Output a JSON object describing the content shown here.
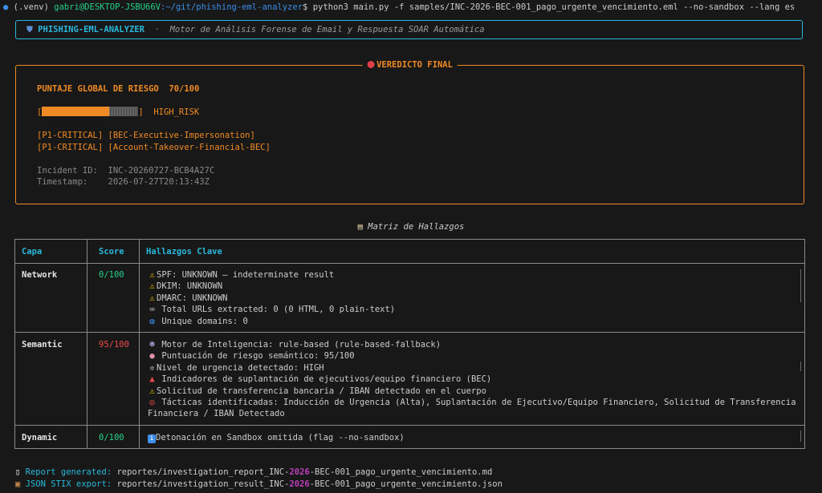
{
  "prompt": {
    "venv": "(.venv)",
    "user_host": "gabri@DESKTOP-JSBU66V",
    "path": ":~/git/phishing-eml-analyzer",
    "dollar": "$",
    "command": "python3 main.py -f samples/INC-2026-BEC-001_pago_urgente_vencimiento.eml --no-sandbox --lang es"
  },
  "banner": {
    "title": "PHISHING-EML-ANALYZER",
    "separator": "·",
    "subtitle": "Motor de Análisis Forense de Email y Respuesta SOAR Automática"
  },
  "verdict": {
    "title": "VEREDICTO FINAL",
    "score_label": "PUNTAJE GLOBAL DE RIESGO",
    "score_value": "70/100",
    "bar_fraction": 0.7,
    "bar_open": "[",
    "bar_close": "]",
    "risk_level": "HIGH_RISK",
    "tags": [
      "[P1-CRITICAL] [BEC-Executive-Impersonation]",
      "[P1-CRITICAL] [Account-Takeover-Financial-BEC]"
    ],
    "incident_label": "Incident ID:",
    "incident_id": "INC-20260727-BCB4A27C",
    "timestamp_label": "Timestamp:",
    "timestamp": "2026-07-27T20:13:43Z"
  },
  "table": {
    "title": "Matriz de Hallazgos",
    "headers": [
      "Capa",
      "Score",
      "Hallazgos Clave"
    ],
    "rows": [
      {
        "layer": "Network",
        "score": "0/100",
        "findings": [
          "SPF: UNKNOWN — indeterminate result",
          "DKIM: UNKNOWN",
          "DMARC: UNKNOWN",
          "Total URLs extracted: 0 (0 HTML, 0 plain-text)",
          "Unique domains: 0"
        ]
      },
      {
        "layer": "Semantic",
        "score": "95/100",
        "findings": [
          "Motor de Inteligencia: rule-based (rule-based-fallback)",
          "Puntuación de riesgo semántico: 95/100",
          "Nivel de urgencia detectado: HIGH",
          "Indicadores de suplantación de ejecutivos/equipo financiero (BEC)",
          "Solicitud de transferencia bancaria / IBAN detectado en el cuerpo",
          "Tácticas identificadas: Inducción de Urgencia (Alta), Suplantación de Ejecutivo/Equipo Financiero, Solicitud de Transferencia",
          "Financiera / IBAN Detectado"
        ]
      },
      {
        "layer": "Dynamic",
        "score": "0/100",
        "findings": [
          "Detonación en Sandbox omitida (flag --no-sandbox)"
        ]
      }
    ]
  },
  "footer": {
    "report_label": "Report generated:",
    "report_pre": "reportes/investigation_report_INC-",
    "report_year": "2026",
    "report_post": "-BEC-001_pago_urgente_vencimiento.md",
    "json_label": "JSON STIX export:",
    "json_pre": "reportes/investigation_result_INC-",
    "json_year": "2026",
    "json_post": "-BEC-001_pago_urgente_vencimiento.json"
  },
  "colors": {
    "background": "#181818",
    "cyan": "#29b8db",
    "orange": "#f08a24",
    "green": "#23d18b",
    "red": "#f14c4c"
  }
}
